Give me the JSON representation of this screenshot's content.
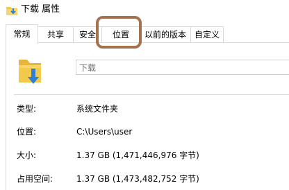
{
  "window": {
    "title": "下载 属性"
  },
  "tabs": [
    {
      "label": "常规",
      "active": true
    },
    {
      "label": "共享",
      "active": false
    },
    {
      "label": "安全",
      "active": false
    },
    {
      "label": "位置",
      "active": false,
      "highlighted": true
    },
    {
      "label": "以前的版本",
      "active": false
    },
    {
      "label": "自定义",
      "active": false
    }
  ],
  "general": {
    "folder_name": "下载",
    "properties": [
      {
        "label": "类型:",
        "value": "系统文件夹"
      },
      {
        "label": "位置:",
        "value": "C:\\Users\\user"
      },
      {
        "label": "大小:",
        "value": "1.37 GB (1,471,446,976 字节)"
      },
      {
        "label": "占用空间:",
        "value": "1.37 GB (1,473,482,752 字节)"
      }
    ]
  },
  "colors": {
    "highlight_border": "#a57250",
    "folder_yellow": "#f3c94b",
    "download_arrow": "#2f7fd6"
  },
  "icons": {
    "title": "downloads-folder-icon",
    "folder": "downloads-folder-icon"
  }
}
